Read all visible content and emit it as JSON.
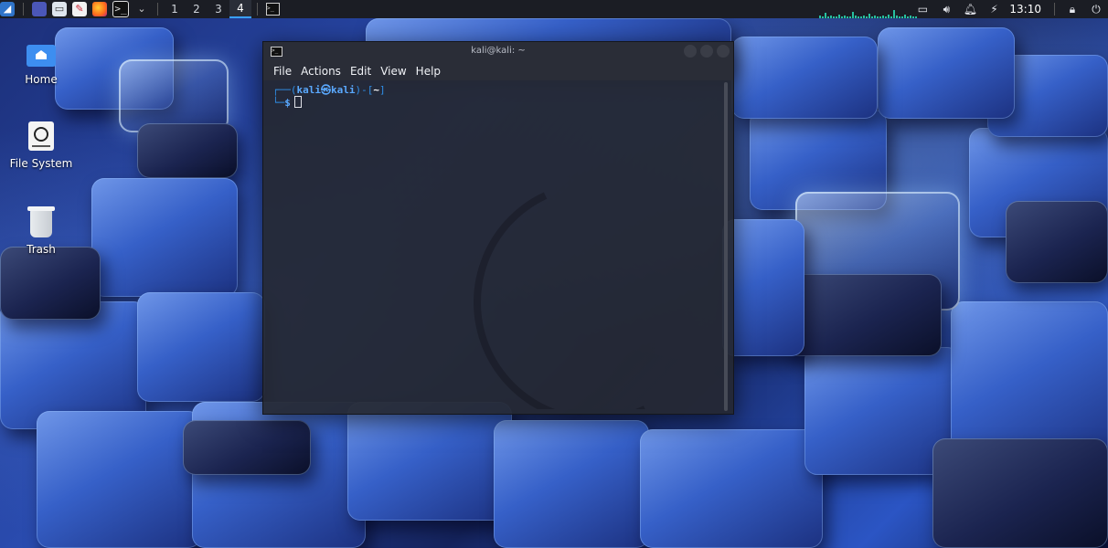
{
  "panel": {
    "launchers": [
      {
        "icon": "kali-menu-icon"
      },
      {
        "icon": "files-app-icon"
      },
      {
        "icon": "mail-app-icon"
      },
      {
        "icon": "text-editor-icon"
      },
      {
        "icon": "firefox-icon"
      },
      {
        "icon": "terminal-icon"
      },
      {
        "icon": "chevron-down-icon"
      }
    ],
    "workspaces": [
      "1",
      "2",
      "3",
      "4"
    ],
    "active_workspace": "4",
    "clock": "13:10"
  },
  "desktop": {
    "icons": [
      {
        "label": "Home",
        "icon": "home-folder-icon"
      },
      {
        "label": "File System",
        "icon": "drive-icon"
      },
      {
        "label": "Trash",
        "icon": "trash-icon"
      }
    ]
  },
  "terminal": {
    "title": "kali@kali: ~",
    "menu": [
      "File",
      "Actions",
      "Edit",
      "View",
      "Help"
    ],
    "prompt_top_left": "┌──(",
    "prompt_user": "kali㉿kali",
    "prompt_mid": ")-[",
    "prompt_dir": "~",
    "prompt_end": "]",
    "prompt_bottom": "└─",
    "prompt_symbol": "$"
  },
  "colors": {
    "panel_bg": "#1b1d24",
    "accent": "#3aa0ff",
    "terminal_bg": "#252832",
    "prompt_blue": "#2f8fe8"
  }
}
